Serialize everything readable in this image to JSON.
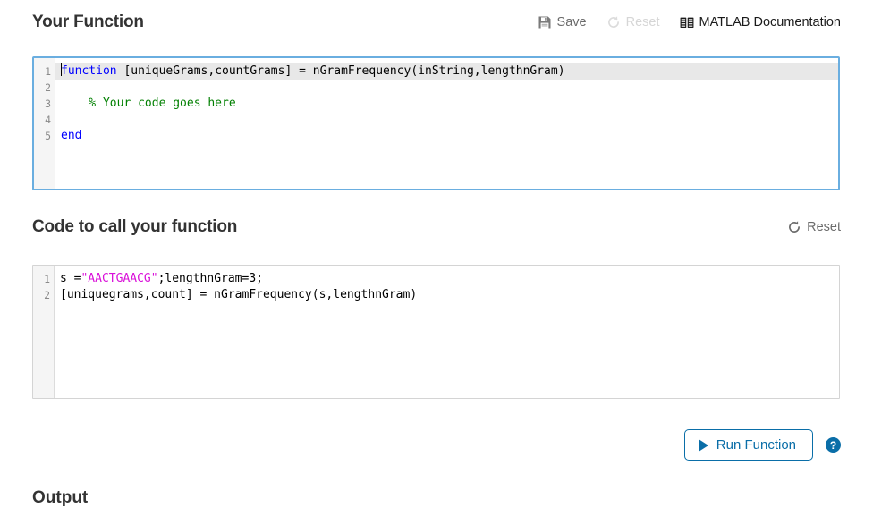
{
  "function_section": {
    "title": "Your Function",
    "toolbar": {
      "save_label": "Save",
      "save_icon": "floppy-disk-icon",
      "reset_label": "Reset",
      "reset_icon": "refresh-icon",
      "reset_disabled": true,
      "docs_label": "MATLAB Documentation",
      "docs_icon": "book-icon"
    },
    "editor": {
      "focused": true,
      "line_numbers": [
        "1",
        "2",
        "3",
        "4",
        "5"
      ],
      "lines": [
        {
          "n": "1",
          "active": true,
          "tokens": [
            {
              "t": "caret",
              "v": ""
            },
            {
              "t": "kw",
              "v": "function"
            },
            {
              "t": "plain",
              "v": " [uniqueGrams,countGrams] = nGramFrequency(inString,lengthnGram)"
            }
          ]
        },
        {
          "n": "2",
          "active": false,
          "tokens": []
        },
        {
          "n": "3",
          "active": false,
          "tokens": [
            {
              "t": "comment",
              "v": "    % Your code goes here"
            }
          ]
        },
        {
          "n": "4",
          "active": false,
          "tokens": []
        },
        {
          "n": "5",
          "active": false,
          "tokens": [
            {
              "t": "kw",
              "v": "end"
            }
          ]
        }
      ]
    }
  },
  "call_section": {
    "title": "Code to call your function",
    "toolbar": {
      "reset_label": "Reset",
      "reset_icon": "refresh-icon",
      "reset_disabled": false
    },
    "editor": {
      "focused": false,
      "line_numbers": [
        "1",
        "2"
      ],
      "lines": [
        {
          "n": "1",
          "active": false,
          "tokens": [
            {
              "t": "plain",
              "v": "s ="
            },
            {
              "t": "str",
              "v": "\"AACTGAACG\""
            },
            {
              "t": "plain",
              "v": ";lengthnGram=3;"
            }
          ]
        },
        {
          "n": "2",
          "active": false,
          "tokens": [
            {
              "t": "plain",
              "v": "[uniquegrams,count] = nGramFrequency(s,lengthnGram)"
            }
          ]
        }
      ]
    }
  },
  "run": {
    "button_label": "Run Function",
    "play_icon": "play-triangle-icon",
    "help_icon": "question-mark-icon",
    "help_label": "?"
  },
  "output_section": {
    "title": "Output"
  },
  "colors": {
    "accent_blue": "#0a6ea8",
    "focus_border": "#6aaee0",
    "keyword": "#0000ff",
    "comment": "#028002",
    "string": "#d911d9",
    "disabled_grey": "#d6d6d6"
  }
}
